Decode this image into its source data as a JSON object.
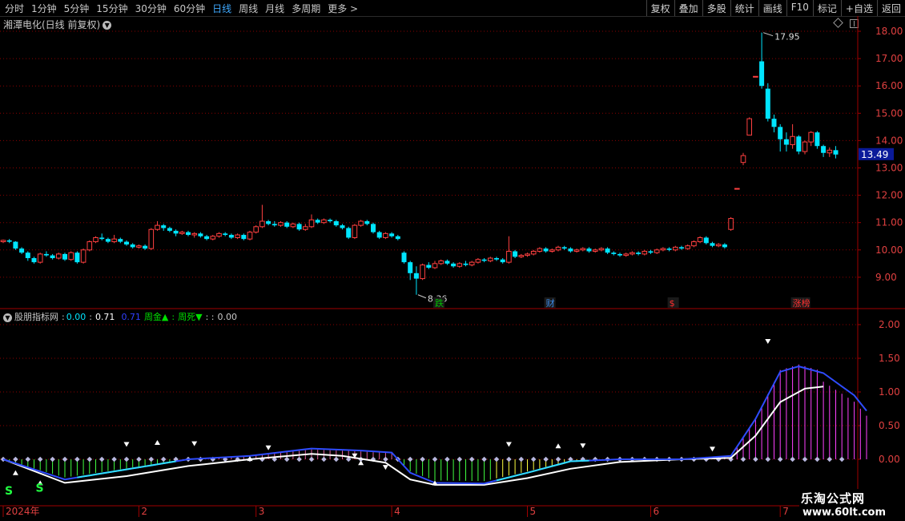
{
  "toolbar": {
    "periods": [
      "分时",
      "1分钟",
      "5分钟",
      "15分钟",
      "30分钟",
      "60分钟",
      "日线",
      "周线",
      "月线",
      "多周期",
      "更多 >"
    ],
    "active_period": "日线",
    "actions": [
      "复权",
      "叠加",
      "多股",
      "统计",
      "画线",
      "F10",
      "标记",
      "+自选",
      "返回"
    ]
  },
  "main": {
    "title": "湘潭电化(日线 前复权)",
    "price_axis": [
      "18.00",
      "17.00",
      "16.00",
      "15.00",
      "14.00",
      "13.00",
      "12.00",
      "11.00",
      "10.00",
      "9.00"
    ],
    "current_price": "13.49",
    "high_label": "17.95",
    "low_label": "8.36",
    "event_tags": [
      {
        "text": "跌",
        "color": "#00c000",
        "day": 70
      },
      {
        "text": "财",
        "color": "#3b8be8",
        "day": 88
      },
      {
        "text": "$",
        "color": "#ff3030",
        "day": 108
      },
      {
        "text": "涨榜",
        "color": "#ff3030",
        "day": 128
      }
    ]
  },
  "indicator": {
    "name": "股朋指标网",
    "v1": "0.00",
    "v2": "0.71",
    "v3": "0.71",
    "label_gold": "周金▲",
    "label_dead": "周死▼",
    "v4": "0.00",
    "axis": [
      "2.00",
      "1.50",
      "1.00",
      "0.50",
      "0.00"
    ],
    "s_marks": [
      "S",
      "S"
    ]
  },
  "time_axis": [
    "2024年",
    "2",
    "3",
    "4",
    "5",
    "6",
    "7"
  ],
  "colors": {
    "up": "#ff4040",
    "down": "#00e5ff",
    "grid": "#8b0000",
    "axis": "#a00000"
  },
  "watermark": {
    "line1": "乐淘公式网",
    "line2": "www.60lt.com"
  },
  "chart_data": [
    {
      "type": "candlestick",
      "x_unit": "trading day index",
      "ylim": [
        8.36,
        17.95
      ],
      "candles": [
        [
          0,
          10.3,
          10.35,
          10.38,
          10.25
        ],
        [
          1,
          10.35,
          10.3,
          10.4,
          10.25
        ],
        [
          2,
          10.3,
          10.05,
          10.32,
          10.0
        ],
        [
          3,
          10.05,
          9.9,
          10.1,
          9.85
        ],
        [
          4,
          9.9,
          9.7,
          9.95,
          9.6
        ],
        [
          5,
          9.7,
          9.55,
          9.75,
          9.5
        ],
        [
          6,
          9.55,
          9.85,
          9.9,
          9.5
        ],
        [
          7,
          9.85,
          9.8,
          9.95,
          9.75
        ],
        [
          8,
          9.8,
          9.7,
          9.85,
          9.65
        ],
        [
          9,
          9.7,
          9.85,
          9.9,
          9.65
        ],
        [
          10,
          9.85,
          9.65,
          9.9,
          9.6
        ],
        [
          11,
          9.65,
          9.9,
          9.95,
          9.6
        ],
        [
          12,
          9.9,
          9.55,
          9.95,
          9.5
        ],
        [
          13,
          9.55,
          10.0,
          10.05,
          9.5
        ],
        [
          14,
          10.0,
          10.3,
          10.35,
          9.95
        ],
        [
          15,
          10.3,
          10.45,
          10.5,
          10.25
        ],
        [
          16,
          10.45,
          10.4,
          10.6,
          10.35
        ],
        [
          17,
          10.4,
          10.3,
          10.45,
          10.25
        ],
        [
          18,
          10.3,
          10.4,
          10.55,
          10.25
        ],
        [
          19,
          10.4,
          10.3,
          10.45,
          10.25
        ],
        [
          20,
          10.3,
          10.2,
          10.35,
          10.15
        ],
        [
          21,
          10.2,
          10.1,
          10.25,
          10.05
        ],
        [
          22,
          10.1,
          10.15,
          10.2,
          10.05
        ],
        [
          23,
          10.15,
          10.05,
          10.2,
          10.0
        ],
        [
          24,
          10.05,
          10.75,
          10.8,
          10.0
        ],
        [
          25,
          10.75,
          10.9,
          11.05,
          10.7
        ],
        [
          26,
          10.9,
          10.8,
          10.95,
          10.7
        ],
        [
          27,
          10.8,
          10.7,
          10.85,
          10.65
        ],
        [
          28,
          10.7,
          10.6,
          10.75,
          10.5
        ],
        [
          29,
          10.6,
          10.65,
          10.7,
          10.55
        ],
        [
          30,
          10.65,
          10.55,
          10.7,
          10.5
        ],
        [
          31,
          10.55,
          10.6,
          10.65,
          10.45
        ],
        [
          32,
          10.6,
          10.5,
          10.65,
          10.45
        ],
        [
          33,
          10.5,
          10.4,
          10.55,
          10.35
        ],
        [
          34,
          10.4,
          10.5,
          10.55,
          10.35
        ],
        [
          35,
          10.5,
          10.6,
          10.65,
          10.45
        ],
        [
          36,
          10.6,
          10.55,
          10.65,
          10.5
        ],
        [
          37,
          10.55,
          10.45,
          10.6,
          10.4
        ],
        [
          38,
          10.45,
          10.55,
          10.6,
          10.4
        ],
        [
          39,
          10.55,
          10.4,
          10.6,
          10.35
        ],
        [
          40,
          10.4,
          10.65,
          10.7,
          10.35
        ],
        [
          41,
          10.65,
          10.85,
          10.9,
          10.6
        ],
        [
          42,
          10.85,
          11.05,
          11.65,
          10.8
        ],
        [
          43,
          11.05,
          10.95,
          11.1,
          10.9
        ],
        [
          44,
          10.95,
          10.9,
          11.05,
          10.85
        ],
        [
          45,
          10.9,
          11.0,
          11.05,
          10.85
        ],
        [
          46,
          11.0,
          10.85,
          11.05,
          10.8
        ],
        [
          47,
          10.85,
          10.95,
          11.0,
          10.8
        ],
        [
          48,
          10.95,
          10.75,
          11.0,
          10.7
        ],
        [
          49,
          10.75,
          10.85,
          10.95,
          10.7
        ],
        [
          50,
          10.85,
          11.1,
          11.3,
          10.8
        ],
        [
          51,
          11.1,
          11.0,
          11.15,
          10.95
        ],
        [
          52,
          11.0,
          11.1,
          11.15,
          10.95
        ],
        [
          53,
          11.1,
          11.05,
          11.15,
          11.0
        ],
        [
          54,
          11.05,
          10.9,
          11.1,
          10.85
        ],
        [
          55,
          10.9,
          10.8,
          10.95,
          10.75
        ],
        [
          56,
          10.8,
          10.45,
          10.85,
          10.4
        ],
        [
          57,
          10.45,
          10.9,
          10.95,
          10.4
        ],
        [
          58,
          10.9,
          11.05,
          11.1,
          10.85
        ],
        [
          59,
          11.05,
          10.95,
          11.1,
          10.9
        ],
        [
          60,
          10.95,
          10.65,
          11.0,
          10.6
        ],
        [
          61,
          10.65,
          10.45,
          10.7,
          10.4
        ],
        [
          62,
          10.45,
          10.6,
          10.65,
          10.4
        ],
        [
          63,
          10.6,
          10.5,
          10.65,
          10.45
        ],
        [
          64,
          10.5,
          10.4,
          10.55,
          10.35
        ],
        [
          65,
          9.9,
          9.55,
          9.95,
          9.5
        ],
        [
          66,
          9.55,
          9.15,
          9.6,
          8.9
        ],
        [
          67,
          9.15,
          8.95,
          9.4,
          8.36
        ],
        [
          68,
          8.95,
          9.45,
          9.5,
          8.9
        ],
        [
          69,
          9.45,
          9.35,
          9.55,
          9.3
        ],
        [
          70,
          9.35,
          9.5,
          9.6,
          9.3
        ],
        [
          71,
          9.5,
          9.6,
          9.65,
          9.45
        ],
        [
          72,
          9.6,
          9.5,
          9.65,
          9.45
        ],
        [
          73,
          9.5,
          9.4,
          9.55,
          9.35
        ],
        [
          74,
          9.4,
          9.5,
          9.55,
          9.35
        ],
        [
          75,
          9.5,
          9.45,
          9.6,
          9.4
        ],
        [
          76,
          9.45,
          9.55,
          9.6,
          9.4
        ],
        [
          77,
          9.55,
          9.65,
          9.7,
          9.5
        ],
        [
          78,
          9.65,
          9.6,
          9.7,
          9.55
        ],
        [
          79,
          9.6,
          9.7,
          9.75,
          9.55
        ],
        [
          80,
          9.7,
          9.65,
          9.75,
          9.6
        ],
        [
          81,
          9.65,
          9.55,
          9.7,
          9.5
        ],
        [
          82,
          9.55,
          9.95,
          10.5,
          9.5
        ],
        [
          83,
          9.95,
          9.75,
          10.0,
          9.7
        ],
        [
          84,
          9.75,
          9.8,
          9.85,
          9.7
        ],
        [
          85,
          9.8,
          9.85,
          9.9,
          9.75
        ],
        [
          86,
          9.85,
          9.95,
          10.0,
          9.8
        ],
        [
          87,
          9.95,
          10.05,
          10.1,
          9.9
        ],
        [
          88,
          10.05,
          9.95,
          10.1,
          9.9
        ],
        [
          89,
          9.95,
          10.0,
          10.05,
          9.9
        ],
        [
          90,
          10.0,
          10.1,
          10.15,
          9.95
        ],
        [
          91,
          10.1,
          10.05,
          10.15,
          10.0
        ],
        [
          92,
          10.05,
          9.95,
          10.1,
          9.9
        ],
        [
          93,
          9.95,
          10.0,
          10.05,
          9.9
        ],
        [
          94,
          10.0,
          10.05,
          10.1,
          9.95
        ],
        [
          95,
          10.05,
          9.95,
          10.1,
          9.9
        ],
        [
          96,
          9.95,
          10.0,
          10.05,
          9.9
        ],
        [
          97,
          10.0,
          10.05,
          10.1,
          9.95
        ],
        [
          98,
          10.05,
          9.9,
          10.1,
          9.85
        ],
        [
          99,
          9.9,
          9.85,
          9.95,
          9.8
        ],
        [
          100,
          9.85,
          9.8,
          9.9,
          9.75
        ],
        [
          101,
          9.8,
          9.85,
          9.9,
          9.75
        ],
        [
          102,
          9.85,
          9.9,
          9.95,
          9.8
        ],
        [
          103,
          9.9,
          9.85,
          9.95,
          9.8
        ],
        [
          104,
          9.85,
          9.95,
          10.0,
          9.8
        ],
        [
          105,
          9.95,
          9.9,
          10.0,
          9.85
        ],
        [
          106,
          9.9,
          10.0,
          10.05,
          9.85
        ],
        [
          107,
          10.0,
          10.05,
          10.1,
          9.95
        ],
        [
          108,
          10.05,
          10.0,
          10.1,
          9.95
        ],
        [
          109,
          10.0,
          10.1,
          10.15,
          9.95
        ],
        [
          110,
          10.1,
          10.05,
          10.15,
          10.0
        ],
        [
          111,
          10.05,
          10.15,
          10.2,
          10.0
        ],
        [
          112,
          10.15,
          10.3,
          10.35,
          10.1
        ],
        [
          113,
          10.3,
          10.45,
          10.5,
          10.25
        ],
        [
          114,
          10.45,
          10.25,
          10.5,
          10.2
        ],
        [
          115,
          10.25,
          10.15,
          10.3,
          10.1
        ],
        [
          116,
          10.15,
          10.2,
          10.25,
          10.1
        ],
        [
          117,
          10.2,
          10.1,
          10.25,
          10.05
        ],
        [
          118,
          10.75,
          11.15,
          11.2,
          10.7
        ],
        [
          119,
          12.25,
          12.25,
          12.25,
          12.25
        ],
        [
          120,
          13.2,
          13.45,
          13.55,
          13.1
        ],
        [
          121,
          14.2,
          14.8,
          14.85,
          14.2
        ],
        [
          122,
          16.35,
          16.35,
          16.35,
          16.35
        ],
        [
          123,
          16.9,
          16.0,
          17.95,
          15.9
        ],
        [
          124,
          15.9,
          14.8,
          16.1,
          14.7
        ],
        [
          125,
          14.8,
          14.5,
          14.95,
          14.3
        ],
        [
          126,
          14.5,
          14.05,
          14.6,
          13.6
        ],
        [
          127,
          14.05,
          13.85,
          14.3,
          13.6
        ],
        [
          128,
          13.85,
          14.15,
          14.6,
          13.7
        ],
        [
          129,
          14.15,
          13.6,
          14.2,
          13.5
        ],
        [
          130,
          13.6,
          13.95,
          14.0,
          13.5
        ],
        [
          131,
          13.95,
          14.3,
          14.35,
          13.8
        ],
        [
          132,
          14.3,
          13.8,
          14.35,
          13.7
        ],
        [
          133,
          13.8,
          13.55,
          13.85,
          13.4
        ],
        [
          134,
          13.55,
          13.65,
          13.75,
          13.4
        ],
        [
          135,
          13.65,
          13.49,
          13.8,
          13.35
        ]
      ]
    },
    {
      "type": "line",
      "x_unit": "trading day index",
      "ylim": [
        0,
        2
      ],
      "series": [
        {
          "color": "#ffffff",
          "points": [
            [
              0,
              0.0
            ],
            [
              10,
              -0.35
            ],
            [
              20,
              -0.25
            ],
            [
              30,
              -0.1
            ],
            [
              40,
              0.0
            ],
            [
              50,
              0.08
            ],
            [
              55,
              0.05
            ],
            [
              62,
              -0.05
            ],
            [
              66,
              -0.3
            ],
            [
              70,
              -0.38
            ],
            [
              78,
              -0.38
            ],
            [
              85,
              -0.28
            ],
            [
              92,
              -0.14
            ],
            [
              100,
              -0.04
            ],
            [
              110,
              0.0
            ],
            [
              118,
              0.02
            ],
            [
              122,
              0.35
            ],
            [
              126,
              0.85
            ],
            [
              130,
              1.05
            ],
            [
              133,
              1.08
            ]
          ]
        },
        {
          "color": "#3aa0ff",
          "points": [
            [
              0,
              0.0
            ],
            [
              10,
              -0.3
            ],
            [
              20,
              -0.15
            ],
            [
              30,
              0.0
            ],
            [
              40,
              0.05
            ],
            [
              50,
              0.16
            ],
            [
              58,
              0.13
            ],
            [
              63,
              0.1
            ],
            [
              66,
              -0.2
            ],
            [
              70,
              -0.35
            ],
            [
              78,
              -0.36
            ],
            [
              85,
              -0.2
            ],
            [
              92,
              -0.03
            ],
            [
              100,
              0.0
            ],
            [
              110,
              0.0
            ],
            [
              118,
              0.05
            ],
            [
              122,
              0.6
            ],
            [
              126,
              1.3
            ],
            [
              129,
              1.38
            ],
            [
              133,
              1.28
            ],
            [
              138,
              0.95
            ],
            [
              140,
              0.72
            ]
          ]
        }
      ],
      "histogram_day_range": [
        0,
        140
      ]
    }
  ]
}
